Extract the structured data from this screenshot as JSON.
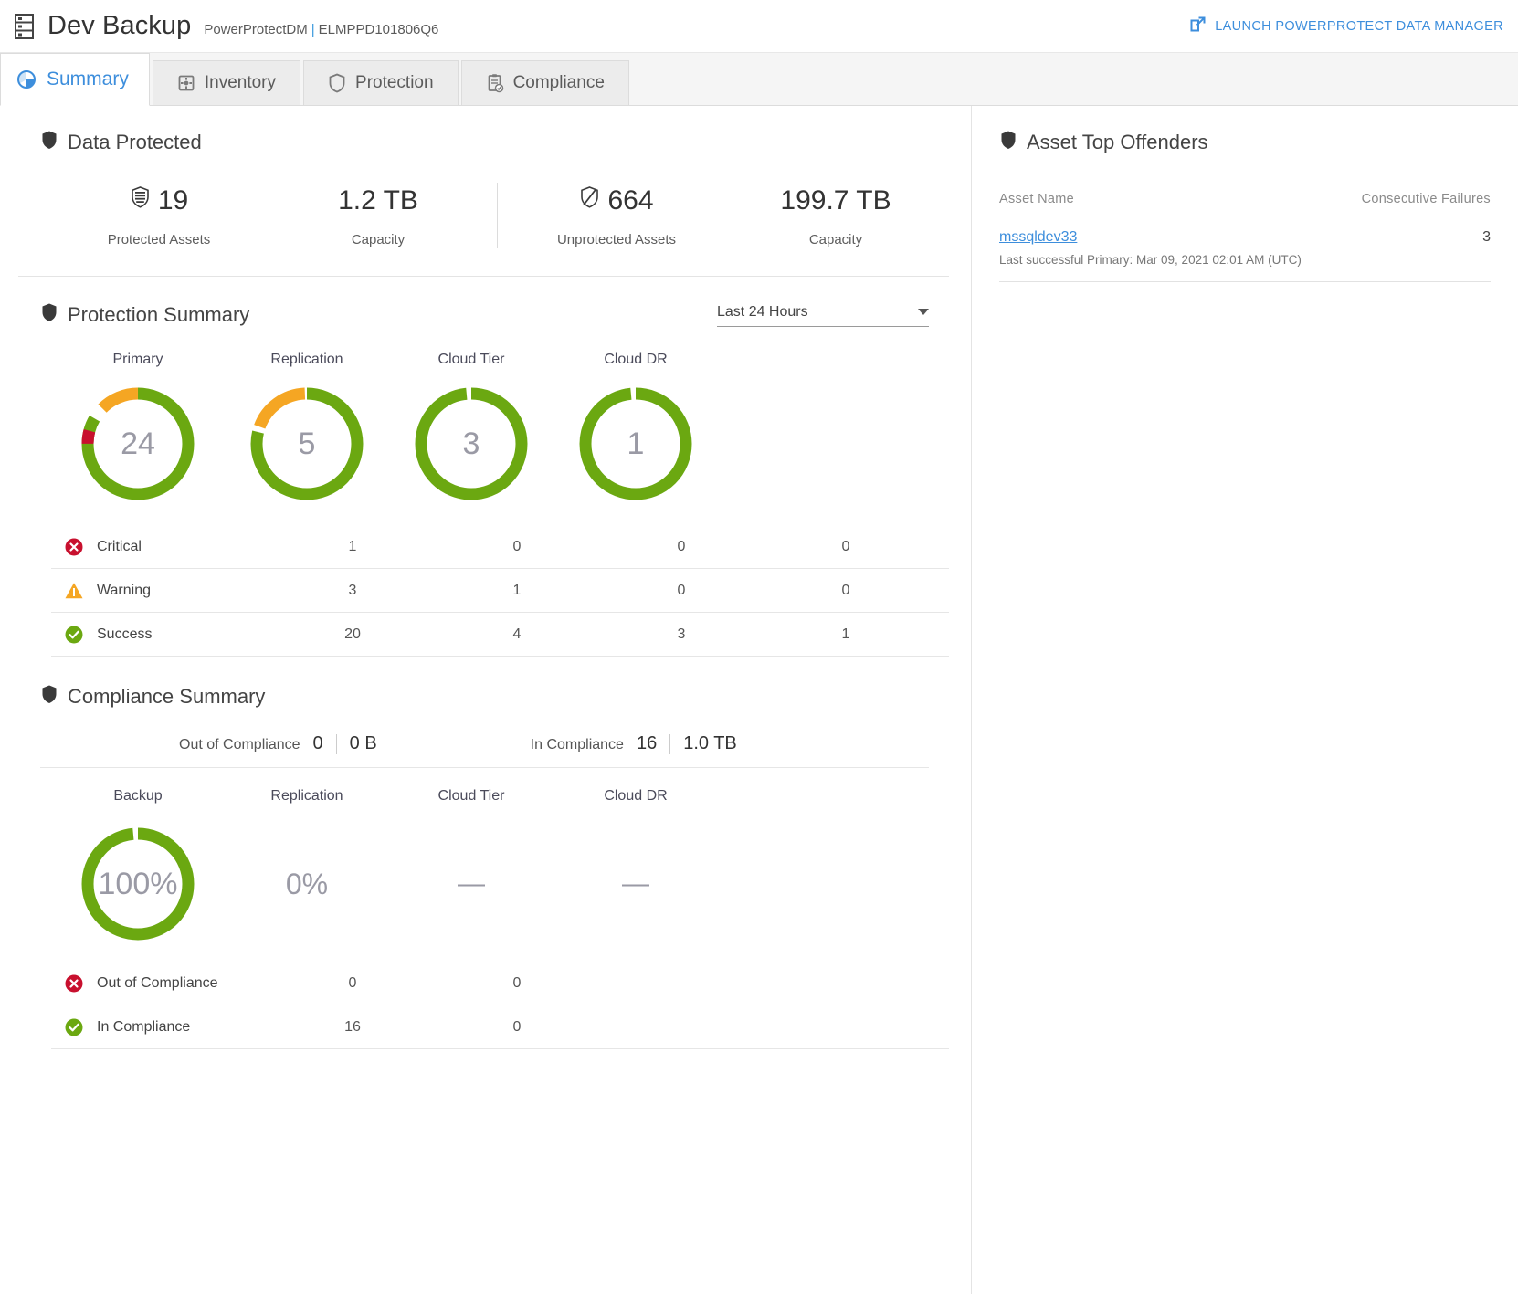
{
  "header": {
    "icon": "server-rack-icon",
    "title": "Dev Backup",
    "subtitle_product": "PowerProtectDM",
    "subtitle_sep": "|",
    "subtitle_system": "ELMPPD101806Q6",
    "launch_label": "LAUNCH POWERPROTECT DATA MANAGER",
    "launch_icon": "external-link-icon",
    "link_color": "#3d8edc"
  },
  "tabs": [
    {
      "label": "Summary",
      "icon": "pie-chart-icon",
      "active": true
    },
    {
      "label": "Inventory",
      "icon": "inventory-box-icon",
      "active": false
    },
    {
      "label": "Protection",
      "icon": "shield-icon",
      "active": false
    },
    {
      "label": "Compliance",
      "icon": "clipboard-check-icon",
      "active": false
    }
  ],
  "data_protected": {
    "title": "Data Protected",
    "icon": "shield-icon",
    "stats": [
      {
        "value": "19",
        "label": "Protected Assets",
        "icon": "shield-filled-icon"
      },
      {
        "value": "1.2 TB",
        "label": "Capacity",
        "icon": ""
      },
      {
        "value": "664",
        "label": "Unprotected Assets",
        "icon": "shield-slash-icon"
      },
      {
        "value": "199.7 TB",
        "label": "Capacity",
        "icon": ""
      }
    ]
  },
  "protection_summary": {
    "title": "Protection Summary",
    "icon": "shield-icon",
    "range_selected": "Last 24 Hours",
    "columns": [
      "Primary",
      "Replication",
      "Cloud Tier",
      "Cloud DR"
    ],
    "donuts": [
      {
        "label": "Primary",
        "total": "24",
        "critical": 1,
        "warning": 3,
        "success": 20
      },
      {
        "label": "Replication",
        "total": "5",
        "critical": 0,
        "warning": 1,
        "success": 4
      },
      {
        "label": "Cloud Tier",
        "total": "3",
        "critical": 0,
        "warning": 0,
        "success": 3
      },
      {
        "label": "Cloud DR",
        "total": "1",
        "critical": 0,
        "warning": 0,
        "success": 1
      }
    ],
    "rows": [
      {
        "status": "Critical",
        "icon": "error-circle-icon",
        "color": "#c8102e",
        "values": [
          "1",
          "0",
          "0",
          "0"
        ]
      },
      {
        "status": "Warning",
        "icon": "warning-triangle-icon",
        "color": "#f5a623",
        "values": [
          "3",
          "1",
          "0",
          "0"
        ]
      },
      {
        "status": "Success",
        "icon": "success-check-icon",
        "color": "#6ba811",
        "values": [
          "20",
          "4",
          "3",
          "1"
        ]
      }
    ]
  },
  "compliance_summary": {
    "title": "Compliance Summary",
    "icon": "shield-icon",
    "out_label": "Out of Compliance",
    "out_count": "0",
    "out_size": "0 B",
    "in_label": "In Compliance",
    "in_count": "16",
    "in_size": "1.0 TB",
    "columns": [
      "Backup",
      "Replication",
      "Cloud Tier",
      "Cloud DR"
    ],
    "gauges": [
      {
        "label": "Backup",
        "display": "100%",
        "percent": 100,
        "kind": "donut"
      },
      {
        "label": "Replication",
        "display": "0%",
        "percent": 0,
        "kind": "text"
      },
      {
        "label": "Cloud Tier",
        "display": "—",
        "percent": null,
        "kind": "dash"
      },
      {
        "label": "Cloud DR",
        "display": "—",
        "percent": null,
        "kind": "dash"
      }
    ],
    "rows": [
      {
        "status": "Out of Compliance",
        "icon": "error-circle-icon",
        "color": "#c8102e",
        "values": [
          "0",
          "0",
          "",
          ""
        ]
      },
      {
        "status": "In Compliance",
        "icon": "success-check-icon",
        "color": "#6ba811",
        "values": [
          "16",
          "0",
          "",
          ""
        ]
      }
    ]
  },
  "asset_top_offenders": {
    "title": "Asset Top Offenders",
    "icon": "shield-icon",
    "col_name": "Asset Name",
    "col_failures": "Consecutive Failures",
    "rows": [
      {
        "name": "mssqldev33",
        "failures": "3",
        "detail": "Last successful Primary: Mar 09, 2021 02:01 AM (UTC)"
      }
    ]
  },
  "chart_data": [
    {
      "type": "pie",
      "title": "Protection Summary - Primary",
      "labels": [
        "Success",
        "Warning",
        "Critical"
      ],
      "values": [
        20,
        3,
        1
      ],
      "colors": [
        "#6ba811",
        "#f5a623",
        "#c8102e"
      ],
      "center_label": "24"
    },
    {
      "type": "pie",
      "title": "Protection Summary - Replication",
      "labels": [
        "Success",
        "Warning",
        "Critical"
      ],
      "values": [
        4,
        1,
        0
      ],
      "colors": [
        "#6ba811",
        "#f5a623",
        "#c8102e"
      ],
      "center_label": "5"
    },
    {
      "type": "pie",
      "title": "Protection Summary - Cloud Tier",
      "labels": [
        "Success",
        "Warning",
        "Critical"
      ],
      "values": [
        3,
        0,
        0
      ],
      "colors": [
        "#6ba811",
        "#f5a623",
        "#c8102e"
      ],
      "center_label": "3"
    },
    {
      "type": "pie",
      "title": "Protection Summary - Cloud DR",
      "labels": [
        "Success",
        "Warning",
        "Critical"
      ],
      "values": [
        1,
        0,
        0
      ],
      "colors": [
        "#6ba811",
        "#f5a623",
        "#c8102e"
      ],
      "center_label": "1"
    },
    {
      "type": "pie",
      "title": "Compliance Summary - Backup",
      "labels": [
        "In Compliance",
        "Out of Compliance"
      ],
      "values": [
        100,
        0
      ],
      "colors": [
        "#6ba811",
        "#e6e6e6"
      ],
      "center_label": "100%"
    }
  ]
}
